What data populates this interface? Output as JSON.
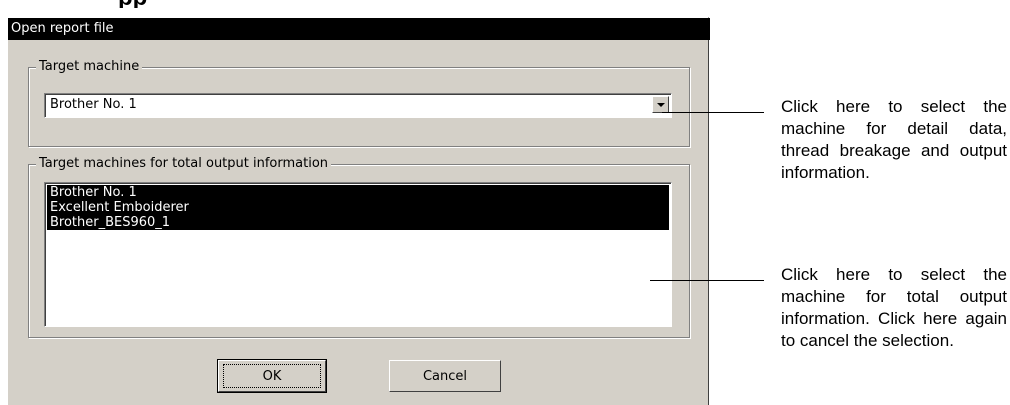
{
  "dialog": {
    "title": "Open report file",
    "target_machine": {
      "legend": "Target machine",
      "selected": "Brother No. 1"
    },
    "total_output": {
      "legend": "Target machines for total output information",
      "items": [
        "Brother No. 1",
        "Excellent Emboiderer",
        "Brother_BES960_1"
      ]
    },
    "buttons": {
      "ok": "OK",
      "cancel": "Cancel"
    }
  },
  "callouts": [
    "Click here to select the machine for detail data, thread breakage and output information.",
    "Click here to select the machine for total output information. Click here again to cancel the selection."
  ],
  "heading_fragment": "pp",
  "colors": {
    "titlebar": "#000000",
    "dialog_face": "#d4d0c8",
    "selection": "#000000"
  }
}
